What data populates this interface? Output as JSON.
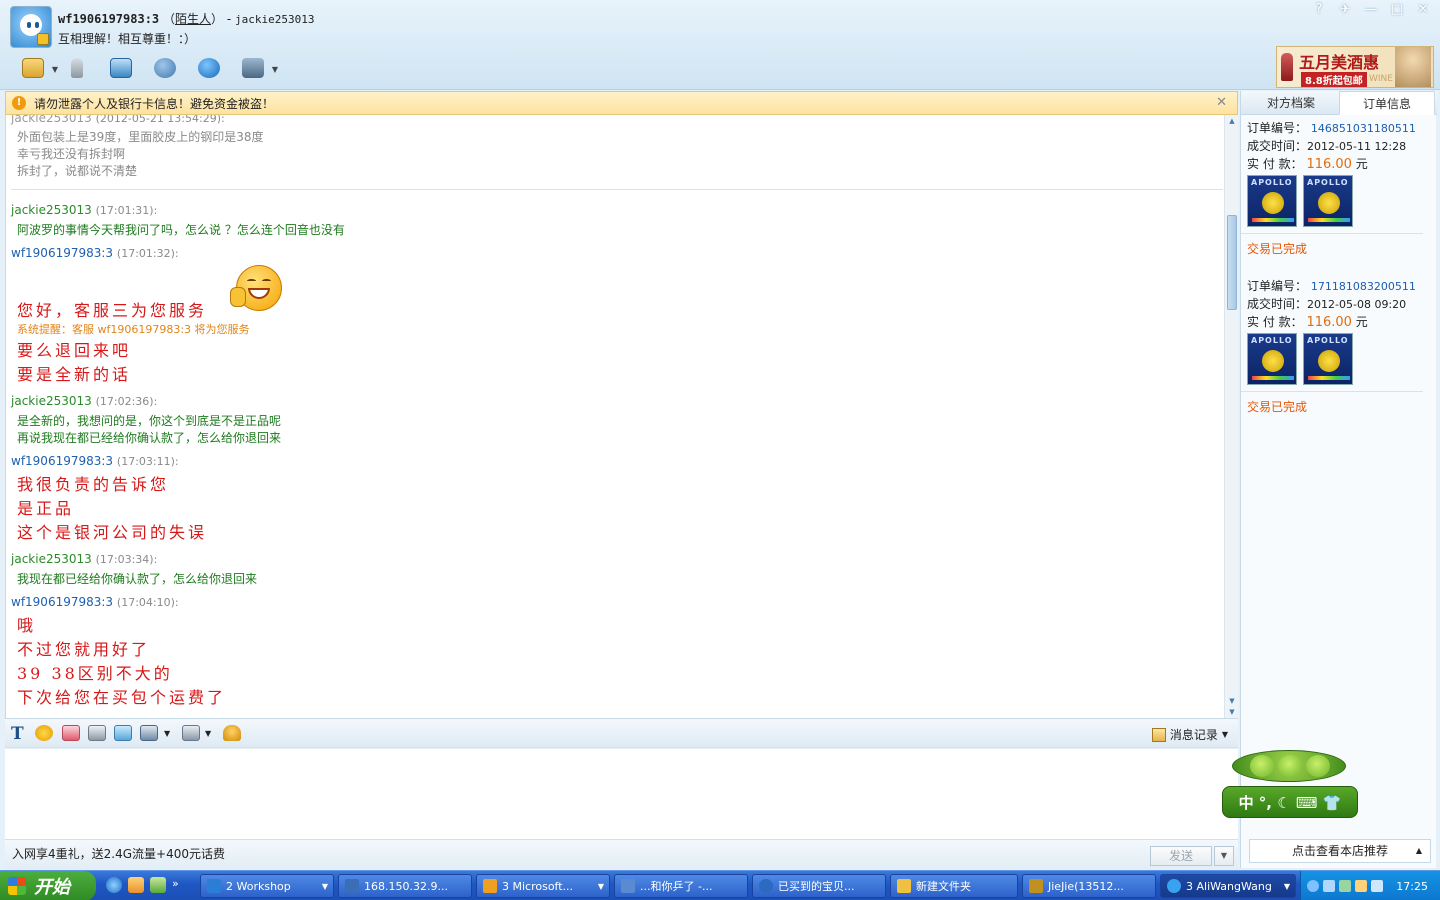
{
  "window": {
    "contact_id": "wf1906197983:3",
    "contact_tag": "陌生人",
    "paren_open": "（",
    "paren_close": "）",
    "dash": " - ",
    "self_id": "jackie253013",
    "signature": "互相理解！相互尊重！：）",
    "controls": [
      "?",
      "✈",
      "—",
      "□",
      "✕"
    ]
  },
  "toolbar": {
    "icons": [
      "folder-icon",
      "microphone-icon",
      "video-icon",
      "add-contact-icon",
      "globe-icon",
      "person-icon"
    ]
  },
  "ad": {
    "title": "五月美酒惠",
    "subtitle": "8.8折起包邮",
    "wine": "WINE"
  },
  "warning": {
    "icon": "!",
    "text": "请勿泄露个人及银行卡信息！避免资金被盗！",
    "close": "✕"
  },
  "chat": {
    "old_header_name": "jackie253013",
    "old_header_time": "(2012-05-21 13:54:29):",
    "old_lines": [
      "外面包装上是39度，里面胶皮上的钢印是38度",
      "幸亏我还没有拆封啊",
      "拆封了，说都说不清楚"
    ],
    "messages": [
      {
        "name": "jackie253013",
        "time": "(17:01:31):",
        "lines": [
          "阿波罗的事情今天帮我问了吗，怎么说 ？怎么连个回音也没有"
        ]
      },
      {
        "name": "wf1906197983:3",
        "time": "(17:01:32):",
        "greeting": "您好，客服三为您服务",
        "system": "系统提醒：客服 wf1906197983:3 将为您服务",
        "lines": [
          "要么退回来吧",
          "要是全新的话"
        ]
      },
      {
        "name": "jackie253013",
        "time": "(17:02:36):",
        "lines": [
          "是全新的，我想问的是，你这个到底是不是正品呢",
          "再说我现在都已经给你确认款了，怎么给你退回来"
        ]
      },
      {
        "name": "wf1906197983:3",
        "time": "(17:03:11):",
        "lines": [
          "我很负责的告诉您",
          "是正品",
          "这个是银河公司的失误"
        ]
      },
      {
        "name": "jackie253013",
        "time": "(17:03:34):",
        "lines": [
          "我现在都已经给你确认款了，怎么给你退回来"
        ]
      },
      {
        "name": "wf1906197983:3",
        "time": "(17:04:10):",
        "lines": [
          "哦",
          "不过您就用好了",
          "39 38区别不大的",
          "下次给您在买包个运费了"
        ]
      }
    ]
  },
  "format_bar": {
    "font_label": "T",
    "icons": [
      "emoticon-icon",
      "gift-icon",
      "screenshot-icon",
      "image-icon",
      "frame-icon",
      "more-icon",
      "bell-icon"
    ],
    "history_label": "消息记录",
    "history_caret": "▼"
  },
  "bottom": {
    "promo": "入网享4重礼，送2.4G流量+400元话费",
    "send": "发送",
    "send_caret": "▼"
  },
  "right_panel": {
    "tabs": [
      "对方档案",
      "订单信息"
    ],
    "labels": {
      "order_no": "订单编号：",
      "deal_time": "成交时间：",
      "paid": "实 付 款：",
      "unit": "元"
    },
    "orders": [
      {
        "number": "146851031180511",
        "time": "2012-05-11 12:28",
        "price": "116.00",
        "status": "交易已完成",
        "product_label": "APOLLO"
      },
      {
        "number": "171181083200511",
        "time": "2012-05-08 09:20",
        "price": "116.00",
        "status": "交易已完成",
        "product_label": "APOLLO"
      }
    ],
    "ime": "中 °, ☾ ⌨ 👕",
    "recommend": "点击查看本店推荐",
    "recommend_caret": "▲"
  },
  "taskbar": {
    "start": "开始",
    "quick_more": "»",
    "tasks": [
      {
        "label": "2 Workshop",
        "caret": "▼",
        "color": "#2a7ed6"
      },
      {
        "label": "168.150.32.9...",
        "caret": "",
        "color": "#3a6fb8"
      },
      {
        "label": "3 Microsoft...",
        "caret": "▼",
        "color": "#f0a020"
      },
      {
        "label": "...和你乒了 -...",
        "caret": "",
        "color": "#5a8ad0"
      },
      {
        "label": "已买到的宝贝...",
        "caret": "",
        "color": "#2a6ac0"
      },
      {
        "label": "新建文件夹",
        "caret": "",
        "color": "#f0c040"
      },
      {
        "label": "JieJie(13512...",
        "caret": "",
        "color": "#c09020"
      },
      {
        "label": "3 AliWangWang",
        "caret": "▼",
        "color": "#3aa0f0"
      }
    ],
    "clock": "17:25"
  }
}
